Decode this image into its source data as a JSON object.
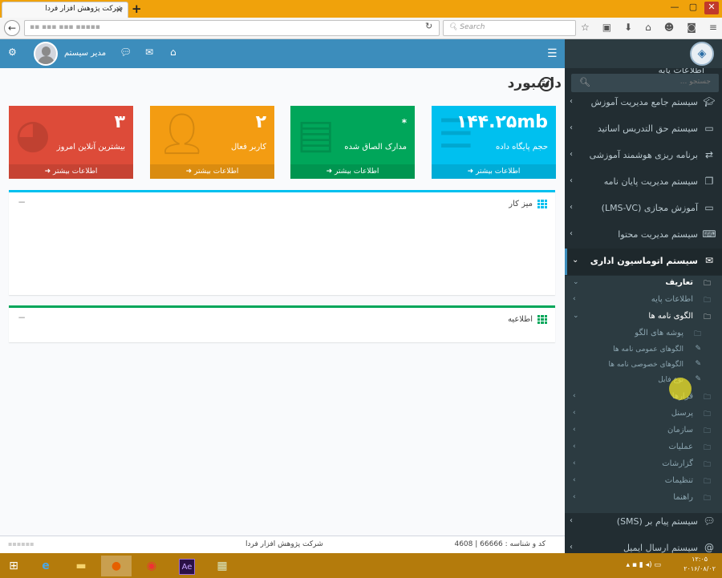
{
  "browser": {
    "tab_title": "شرکت پژوهش افزار فردا",
    "tab_close": "✕",
    "new_tab": "+",
    "url": "▪▪ ▪▪▪ ▪▪▪ ▪▪▪▪▪",
    "search_placeholder": "Search",
    "window_controls": [
      "—",
      "▢",
      "✕"
    ],
    "nav_icons": [
      "☆",
      "▣",
      "⬇",
      "⌂",
      "☻",
      "◙",
      "≡"
    ]
  },
  "header": {
    "user_name": "مدیر سیستم",
    "icons": [
      "share-icon",
      "comments-icon",
      "envelope-icon",
      "home-icon",
      "menu-icon"
    ]
  },
  "page": {
    "title": "داشبورد"
  },
  "stat_boxes": [
    {
      "id": "db",
      "value": "۱۴۴.۲۵mb",
      "label": "حجم پایگاه داده",
      "footer": "اطلاعات بیشتر",
      "color": "#00c0ef"
    },
    {
      "id": "docs",
      "value": "*",
      "label": "مدارک الصاق شده",
      "footer": "اطلاعات بیشتر",
      "color": "#00a65a"
    },
    {
      "id": "users",
      "value": "۲",
      "label": "کاربر فعال",
      "footer": "اطلاعات بیشتر",
      "color": "#f39c12"
    },
    {
      "id": "online",
      "value": "۳",
      "label": "بیشترین آنلاین امروز",
      "footer": "اطلاعات بیشتر",
      "color": "#dd4b39"
    }
  ],
  "panels": {
    "desk": {
      "title": "میز کار",
      "collapse": "−"
    },
    "info": {
      "title": "اطلاعیه",
      "collapse": "−"
    }
  },
  "footer": {
    "code_label": "کد و شناسه : 66666 | 4608",
    "company": "شرکت پژوهش افزار فردا"
  },
  "sidebar": {
    "search_placeholder": "جستجو ...",
    "cut_item": "اطلاعات پایه",
    "items": [
      {
        "label": "سیستم جامع مدیریت آموزش",
        "icon": "graduation-cap-icon"
      },
      {
        "label": "سیستم حق التدریس اساتید",
        "icon": "money-icon"
      },
      {
        "label": "برنامه ریزی هوشمند آموزشی",
        "icon": "exchange-icon"
      },
      {
        "label": "سیستم مدیریت پایان نامه",
        "icon": "files-icon"
      },
      {
        "label": "آموزش مجازی (LMS-VC)",
        "icon": "laptop-icon"
      },
      {
        "label": "سیستم مدیریت محتوا",
        "icon": "keyboard-icon"
      },
      {
        "label": "سیستم اتوماسیون اداری",
        "icon": "envelope-icon"
      },
      {
        "label": "سیستم پیام بر (SMS)",
        "icon": "comments-icon"
      },
      {
        "label": "سیستم ارسال ایمیل",
        "icon": "at-icon"
      }
    ],
    "submenu": {
      "definitions": "تعاریف",
      "base_info": "اطلاعات پایه",
      "letter_templates": "الگوی نامه ها",
      "template_folders": "پوشه های الگو",
      "public_templates": "الگوهای عمومی نامه ها",
      "private_templates": "الگوهای خصوصی نامه ها",
      "file_type": "نوع فایل",
      "contracts": "قرارها",
      "personnel": "پرسنل",
      "organization": "سازمان",
      "operations": "عملیات",
      "reports": "گزارشات",
      "settings": "تنظیمات",
      "guides": "راهنما"
    }
  },
  "taskbar": {
    "clock_time": "۱۲:۰۵",
    "clock_date": "۲۰۱۶/۰۸/۰۲"
  }
}
